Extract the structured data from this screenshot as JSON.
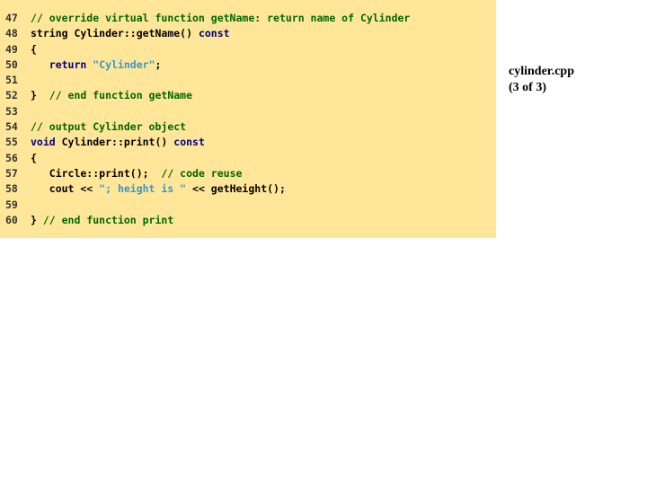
{
  "file": {
    "name": "cylinder.cpp",
    "part": "(3 of 3)"
  },
  "colors": {
    "panel_bg": "#ffe699",
    "comment": "#006600",
    "keyword": "#000080",
    "string": "#3399cc",
    "plain": "#000000"
  },
  "code": [
    {
      "num": "47",
      "tokens": [
        {
          "t": "comment",
          "v": "// override virtual function getName: return name of Cylinder"
        }
      ]
    },
    {
      "num": "48",
      "tokens": [
        {
          "t": "plain",
          "v": "string Cylinder::getName() "
        },
        {
          "t": "keyword",
          "v": "const"
        }
      ]
    },
    {
      "num": "49",
      "tokens": [
        {
          "t": "plain",
          "v": "{"
        }
      ]
    },
    {
      "num": "50",
      "tokens": [
        {
          "t": "plain",
          "v": "   "
        },
        {
          "t": "keyword",
          "v": "return"
        },
        {
          "t": "plain",
          "v": " "
        },
        {
          "t": "string",
          "v": "\"Cylinder\""
        },
        {
          "t": "plain",
          "v": ";"
        }
      ]
    },
    {
      "num": "51",
      "tokens": []
    },
    {
      "num": "52",
      "tokens": [
        {
          "t": "plain",
          "v": "}  "
        },
        {
          "t": "comment",
          "v": "// end function getName"
        }
      ]
    },
    {
      "num": "53",
      "tokens": []
    },
    {
      "num": "54",
      "tokens": [
        {
          "t": "comment",
          "v": "// output Cylinder object"
        }
      ]
    },
    {
      "num": "55",
      "tokens": [
        {
          "t": "keyword",
          "v": "void"
        },
        {
          "t": "plain",
          "v": " Cylinder::print() "
        },
        {
          "t": "keyword",
          "v": "const"
        }
      ]
    },
    {
      "num": "56",
      "tokens": [
        {
          "t": "plain",
          "v": "{"
        }
      ]
    },
    {
      "num": "57",
      "tokens": [
        {
          "t": "plain",
          "v": "   Circle::print();  "
        },
        {
          "t": "comment",
          "v": "// code reuse"
        }
      ]
    },
    {
      "num": "58",
      "tokens": [
        {
          "t": "plain",
          "v": "   cout << "
        },
        {
          "t": "string",
          "v": "\"; height is \""
        },
        {
          "t": "plain",
          "v": " << getHeight();"
        }
      ]
    },
    {
      "num": "59",
      "tokens": []
    },
    {
      "num": "60",
      "tokens": [
        {
          "t": "plain",
          "v": "} "
        },
        {
          "t": "comment",
          "v": "// end function print"
        }
      ]
    }
  ]
}
